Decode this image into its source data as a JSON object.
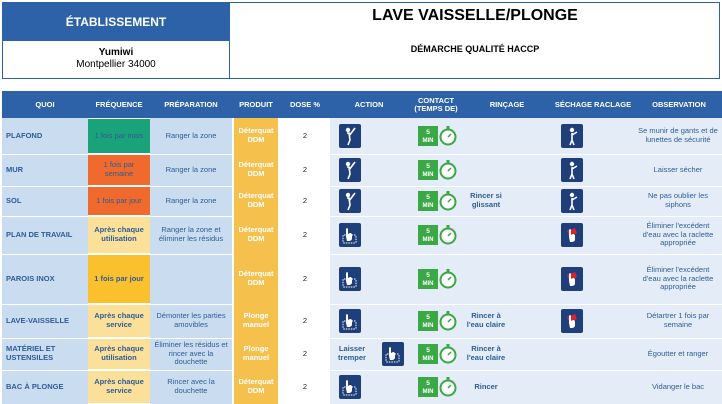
{
  "header": {
    "establishment_label": "ÉTABLISSEMENT",
    "establishment_name": "Yumiwi",
    "establishment_city": "Montpellier 34000",
    "title": "LAVE VAISSELLE/PLONGE",
    "subtitle": "DÉMARCHE QUALITÉ HACCP"
  },
  "columns": {
    "quoi": "QUOI",
    "frequence": "FRÉQUENCE",
    "preparation": "PRÉPARATION",
    "produit": "PRODUIT",
    "dose": "DOSE %",
    "action": "ACTION",
    "contact": "CONTACT (TEMPS DE)",
    "rincage": "RINÇAGE",
    "sechage": "SÉCHAGE RACLAGE",
    "observation": "OBSERVATION"
  },
  "timer_label": "5 MIN",
  "colors": {
    "header_blue": "#2e62a8",
    "freq_green": "#1aa37a",
    "freq_orange": "#ef6a2c",
    "freq_yellow": "#fbc02d",
    "freq_light": "#fbe09a",
    "product": "#f6c04c",
    "timer_green": "#3aa845"
  },
  "rows": [
    {
      "quoi": "PLAFOND",
      "frequence": "1 fois par mois",
      "freq_color": "#1aa37a",
      "preparation": "Ranger la zone",
      "produit": "Déterquat DDM",
      "dose": "2",
      "action": "",
      "action_icon": "mop-icon",
      "rincage": "",
      "sechage_icon": "person-wipe-icon",
      "observation": "Se munir de gants et de lunettes de sécurité"
    },
    {
      "quoi": "MUR",
      "frequence": "1 fois par semaine",
      "freq_color": "#ef6a2c",
      "preparation": "Ranger la zone",
      "produit": "Déterquat DDM",
      "dose": "2",
      "action": "",
      "action_icon": "mop-icon",
      "rincage": "",
      "sechage_icon": "person-wipe-icon",
      "observation": "Laisser sécher"
    },
    {
      "quoi": "SOL",
      "frequence": "1 fois par jour",
      "freq_color": "#ef6a2c",
      "preparation": "Ranger la zone",
      "produit": "Déterquat DDM",
      "dose": "2",
      "action": "",
      "action_icon": "mop-icon",
      "rincage": "Rincer si glissant",
      "sechage_icon": "person-wipe-icon",
      "observation": "Ne pas oublier les siphons"
    },
    {
      "quoi": "PLAN DE TRAVAIL",
      "frequence": "Après chaque utilisation",
      "freq_color": "#fbe09a",
      "preparation": "Ranger la zone et éliminer les résidus",
      "produit": "Déterquat DDM",
      "dose": "2",
      "action": "",
      "action_icon": "hand-sponge-icon",
      "rincage": "",
      "sechage_icon": "hand-scraper-icon",
      "observation": "Éliminer l'excédent d'eau avec la raclette appropriée"
    },
    {
      "quoi": "PAROIS INOX",
      "frequence": "1 fois par jour",
      "freq_color": "#fbc02d",
      "preparation": "",
      "produit": "Déterquat DDM",
      "dose": "2",
      "action": "",
      "action_icon": "hand-sponge-icon",
      "rincage": "",
      "sechage_icon": "hand-scraper-icon",
      "observation": "Éliminer l'excédent d'eau avec la raclette appropriée"
    },
    {
      "quoi": "LAVE-VAISSELLE",
      "frequence": "Après chaque service",
      "freq_color": "#fbe09a",
      "preparation": "Démonter les parties amovibles",
      "produit": "Plonge manuel",
      "dose": "2",
      "action": "",
      "action_icon": "hand-sponge-icon",
      "rincage": "Rincer à l'eau claire",
      "sechage_icon": "hand-scraper-icon",
      "observation": "Détartrer 1 fois par semaine"
    },
    {
      "quoi": "MATÉRIEL ET USTENSILES",
      "frequence": "Après chaque utilisation",
      "freq_color": "#fbe09a",
      "preparation": "Éliminer les résidus et rincer avec la douchette",
      "produit": "Plonge manuel",
      "dose": "2",
      "action": "Laisser tremper",
      "action_icon": "hand-sponge-icon",
      "rincage": "Rincer à l'eau claire",
      "sechage_icon": "",
      "observation": "Égoutter et ranger"
    },
    {
      "quoi": "BAC À PLONGE",
      "frequence": "Après chaque service",
      "freq_color": "#fbe09a",
      "preparation": "Rincer avec la douchette",
      "produit": "Déterquat DDM",
      "dose": "2",
      "action": "",
      "action_icon": "hand-sponge-icon",
      "rincage": "Rincer",
      "sechage_icon": "",
      "observation": "Vidanger le bac"
    }
  ]
}
